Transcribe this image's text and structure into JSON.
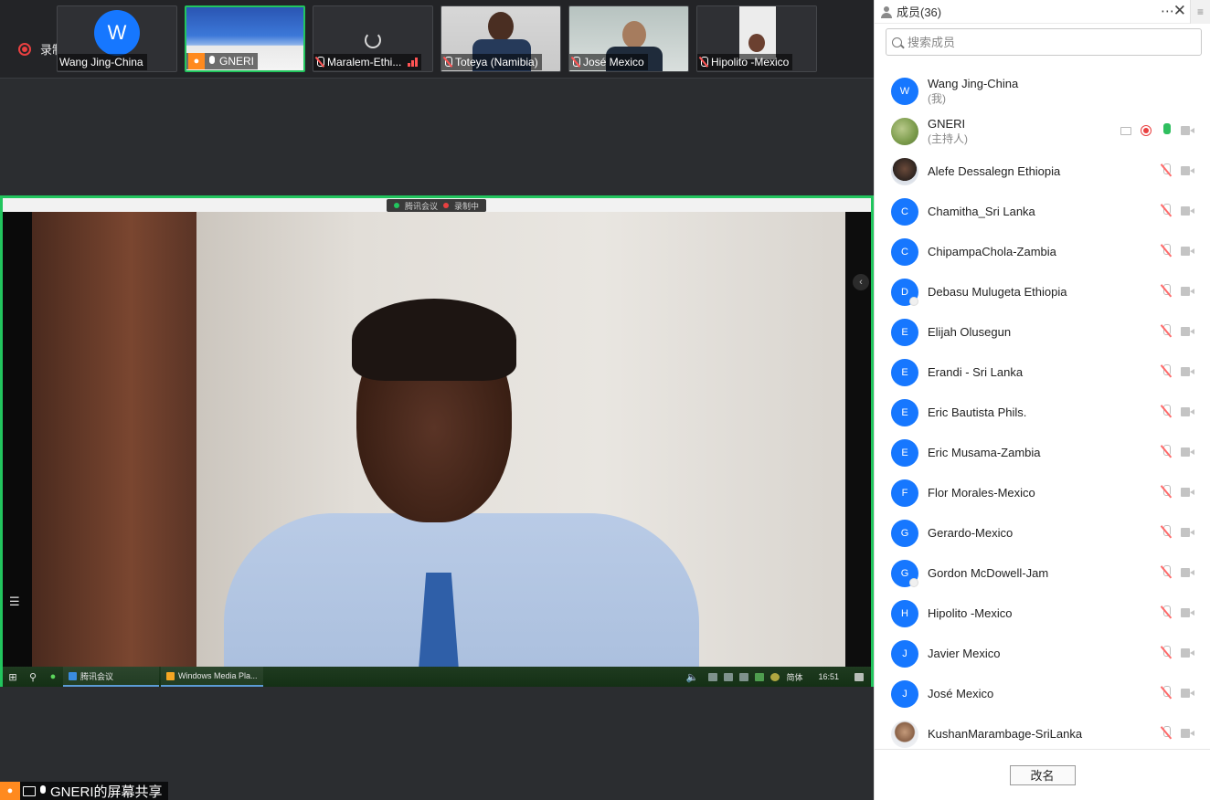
{
  "top_strip": {
    "recording_label": "录制中",
    "tiles": [
      {
        "name": "Wang Jing-China",
        "avatar_letter": "W"
      },
      {
        "name": "GNERI"
      },
      {
        "name": "Maralem-Ethi..."
      },
      {
        "name": "Toteya (Namibia)"
      },
      {
        "name": "José Mexico"
      },
      {
        "name": "Hipolito -Mexico"
      }
    ]
  },
  "shared_screen": {
    "badge_app": "腾讯会议",
    "badge_recording": "录制中",
    "taskbar": {
      "tasks": [
        "腾讯会议",
        "Windows Media Pla..."
      ],
      "ime": "简体",
      "clock": "16:51"
    },
    "share_label": "GNERI的屏幕共享"
  },
  "members_panel": {
    "title": "成员(36)",
    "search_placeholder": "搜索成员",
    "rename_button": "改名",
    "members": [
      {
        "name": "Wang Jing-China",
        "sub": "(我)",
        "letter": "W"
      },
      {
        "name": "GNERI",
        "sub": "(主持人)",
        "letter": ""
      },
      {
        "name": "Alefe Dessalegn Ethiopia",
        "letter": ""
      },
      {
        "name": "Chamitha_Sri Lanka",
        "letter": "C"
      },
      {
        "name": "ChipampaChola-Zambia",
        "letter": "C"
      },
      {
        "name": "Debasu Mulugeta Ethiopia",
        "letter": "D"
      },
      {
        "name": "Elijah Olusegun",
        "letter": "E"
      },
      {
        "name": "Erandi - Sri Lanka",
        "letter": "E"
      },
      {
        "name": "Eric Bautista Phils.",
        "letter": "E"
      },
      {
        "name": "Eric Musama-Zambia",
        "letter": "E"
      },
      {
        "name": "Flor Morales-Mexico",
        "letter": "F"
      },
      {
        "name": "Gerardo-Mexico",
        "letter": "G"
      },
      {
        "name": "Gordon McDowell-Jam",
        "letter": "G"
      },
      {
        "name": "Hipolito -Mexico",
        "letter": "H"
      },
      {
        "name": "Javier Mexico",
        "letter": "J"
      },
      {
        "name": "José Mexico",
        "letter": "J"
      },
      {
        "name": "KushanMarambage-SriLanka",
        "letter": ""
      }
    ]
  }
}
